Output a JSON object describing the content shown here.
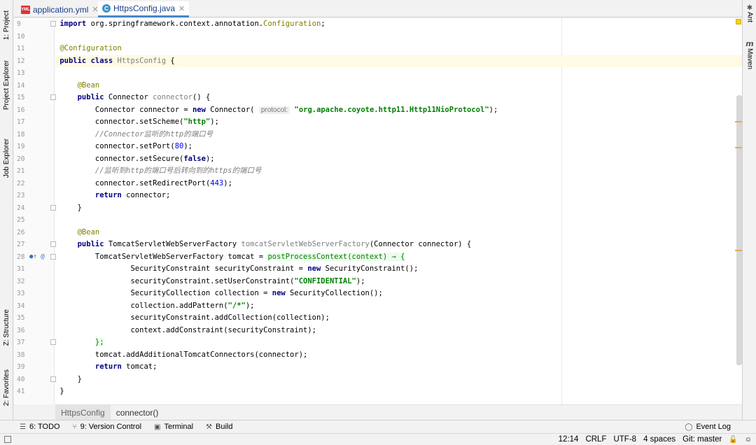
{
  "tabs": [
    {
      "label": "application.yml",
      "icon": "yml-file-icon",
      "active": false
    },
    {
      "label": "HttpsConfig.java",
      "icon": "java-class-icon",
      "active": true
    }
  ],
  "left_tools": [
    "1: Project",
    "Project Explorer",
    "Job Explorer",
    "Z: Structure",
    "2: Favorites"
  ],
  "right_tools": [
    "Ant",
    "Maven"
  ],
  "line_numbers": [
    "9",
    "10",
    "11",
    "12",
    "13",
    "14",
    "15",
    "16",
    "17",
    "18",
    "19",
    "20",
    "21",
    "22",
    "23",
    "24",
    "25",
    "26",
    "27",
    "28",
    "31",
    "32",
    "33",
    "34",
    "35",
    "36",
    "37",
    "38",
    "39",
    "40",
    "41",
    "42"
  ],
  "code": {
    "l9": {
      "kw": "import",
      "rest": " org.springframework.context.annotation.",
      "cls": "Configuration",
      "end": ";"
    },
    "l11": "@Configuration",
    "l12": {
      "kw1": "public",
      "kw2": "class",
      "name": "HttpsConfig",
      "end": " {"
    },
    "l14": "@Bean",
    "l15": {
      "kw": "public",
      "type": "Connector",
      "method": "connector",
      "end": "() {"
    },
    "l16": {
      "a": "Connector connector = ",
      "kw": "new",
      "b": " Connector( ",
      "hint": "protocol:",
      "str": "\"org.apache.coyote.http11.Http11NioProtocol\"",
      "end": ");"
    },
    "l17": {
      "a": "connector.setScheme(",
      "str": "\"http\"",
      "end": ");"
    },
    "l18": "//Connector监听的http的端口号",
    "l19": {
      "a": "connector.setPort(",
      "num": "80",
      "end": ");"
    },
    "l20": {
      "a": "connector.setSecure(",
      "kw": "false",
      "end": ");"
    },
    "l21": "//监听到http的端口号后转向到的https的端口号",
    "l22": {
      "a": "connector.setRedirectPort(",
      "num": "443",
      "end": ");"
    },
    "l23": {
      "kw": "return",
      "end": " connector;"
    },
    "l24": "}",
    "l26": "@Bean",
    "l27": {
      "kw": "public",
      "type": "TomcatServletWebServerFactory",
      "method": "tomcatServletWebServerFactory",
      "end": "(Connector connector) {"
    },
    "l28": {
      "a": "TomcatServletWebServerFactory tomcat = ",
      "lam": "postProcessContext(context) → {"
    },
    "l31": {
      "a": "SecurityConstraint securityConstraint = ",
      "kw": "new",
      "end": " SecurityConstraint();"
    },
    "l32": {
      "a": "securityConstraint.setUserConstraint(",
      "str": "\"CONFIDENTIAL\"",
      "end": ");"
    },
    "l33": {
      "a": "SecurityCollection collection = ",
      "kw": "new",
      "end": " SecurityCollection();"
    },
    "l34": {
      "a": "collection.addPattern(",
      "str": "\"/*\"",
      "end": ");"
    },
    "l35": "securityConstraint.addCollection(collection);",
    "l36": "context.addConstraint(securityConstraint);",
    "l37": "};",
    "l39": "tomcat.addAdditionalTomcatConnectors(connector);",
    "l40": {
      "kw": "return",
      "end": " tomcat;"
    },
    "l41": "}",
    "l42": "}"
  },
  "breadcrumb": [
    "HttpsConfig",
    "connector()"
  ],
  "tool_windows": [
    {
      "label": "6: TODO",
      "icon": "todo-list-icon"
    },
    {
      "label": "9: Version Control",
      "icon": "version-control-icon"
    },
    {
      "label": "Terminal",
      "icon": "terminal-icon"
    },
    {
      "label": "Build",
      "icon": "hammer-icon"
    }
  ],
  "event_log": "Event Log",
  "status": {
    "position": "12:14",
    "line_sep": "CRLF",
    "encoding": "UTF-8",
    "indent": "4 spaces",
    "vcs": "Git: master"
  }
}
